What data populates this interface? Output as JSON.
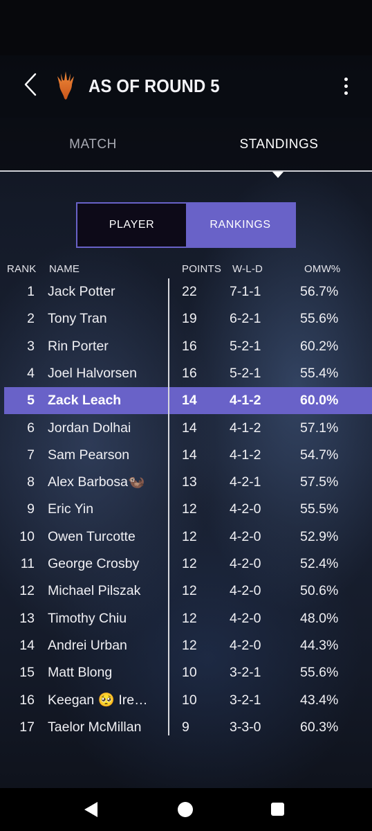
{
  "header": {
    "title": "AS OF ROUND 5"
  },
  "tabs": {
    "match": "MATCH",
    "standings": "STANDINGS"
  },
  "toggle": {
    "player": "PLAYER",
    "rankings": "RANKINGS"
  },
  "colors": {
    "accent": "#6962c8"
  },
  "columns": {
    "rank": "RANK",
    "name": "NAME",
    "points": "POINTS",
    "wld": "W-L-D",
    "omw": "OMW%"
  },
  "rows": [
    {
      "rank": "1",
      "name": "Jack Potter",
      "points": "22",
      "wld": "7-1-1",
      "omw": "56.7%"
    },
    {
      "rank": "2",
      "name": "Tony Tran",
      "points": "19",
      "wld": "6-2-1",
      "omw": "55.6%"
    },
    {
      "rank": "3",
      "name": "Rin Porter",
      "points": "16",
      "wld": "5-2-1",
      "omw": "60.2%"
    },
    {
      "rank": "4",
      "name": "Joel Halvorsen",
      "points": "16",
      "wld": "5-2-1",
      "omw": "55.4%"
    },
    {
      "rank": "5",
      "name": "Zack Leach",
      "points": "14",
      "wld": "4-1-2",
      "omw": "60.0%"
    },
    {
      "rank": "6",
      "name": "Jordan  Dolhai",
      "points": "14",
      "wld": "4-1-2",
      "omw": "57.1%"
    },
    {
      "rank": "7",
      "name": "Sam Pearson",
      "points": "14",
      "wld": "4-1-2",
      "omw": "54.7%"
    },
    {
      "rank": "8",
      "name": "Alex Barbosa🦦",
      "points": "13",
      "wld": "4-2-1",
      "omw": "57.5%"
    },
    {
      "rank": "9",
      "name": "Eric Yin",
      "points": "12",
      "wld": "4-2-0",
      "omw": "55.5%"
    },
    {
      "rank": "10",
      "name": "Owen Turcotte",
      "points": "12",
      "wld": "4-2-0",
      "omw": "52.9%"
    },
    {
      "rank": "11",
      "name": "George Crosby",
      "points": "12",
      "wld": "4-2-0",
      "omw": "52.4%"
    },
    {
      "rank": "12",
      "name": "Michael Pilszak",
      "points": "12",
      "wld": "4-2-0",
      "omw": "50.6%"
    },
    {
      "rank": "13",
      "name": "Timothy Chiu",
      "points": "12",
      "wld": "4-2-0",
      "omw": "48.0%"
    },
    {
      "rank": "14",
      "name": "Andrei  Urban",
      "points": "12",
      "wld": "4-2-0",
      "omw": "44.3%"
    },
    {
      "rank": "15",
      "name": "Matt Blong",
      "points": "10",
      "wld": "3-2-1",
      "omw": "55.6%"
    },
    {
      "rank": "16",
      "name": "Keegan 🥺 Ire…",
      "points": "10",
      "wld": "3-2-1",
      "omw": "43.4%"
    },
    {
      "rank": "17",
      "name": "Taelor McMillan",
      "points": "9",
      "wld": "3-3-0",
      "omw": "60.3%"
    }
  ],
  "highlighted_rank": "5"
}
